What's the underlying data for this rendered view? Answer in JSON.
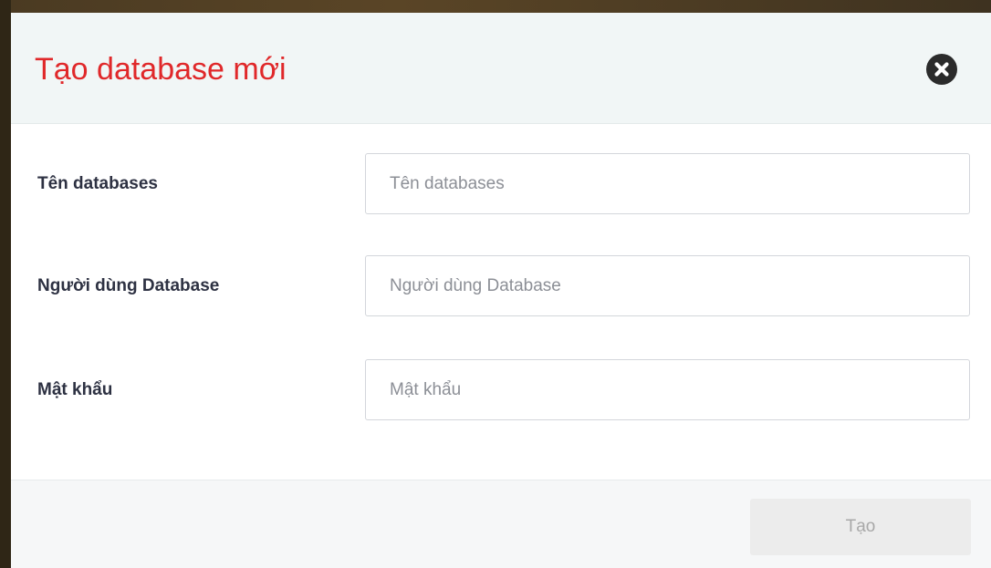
{
  "dialog": {
    "title": "Tạo database mới",
    "close_icon": "close-circle-icon"
  },
  "form": {
    "fields": [
      {
        "label": "Tên databases",
        "placeholder": "Tên databases",
        "value": ""
      },
      {
        "label": "Người dùng Database",
        "placeholder": "Người dùng Database",
        "value": ""
      },
      {
        "label": "Mật khẩu",
        "placeholder": "Mật khẩu",
        "value": ""
      }
    ]
  },
  "footer": {
    "submit_label": "Tạo",
    "submit_disabled": true
  },
  "colors": {
    "title": "#e0282a",
    "header_bg": "#f1f6f6",
    "label": "#2d3142",
    "button_disabled_bg": "#ececec",
    "button_disabled_text": "#a8a8a8"
  }
}
